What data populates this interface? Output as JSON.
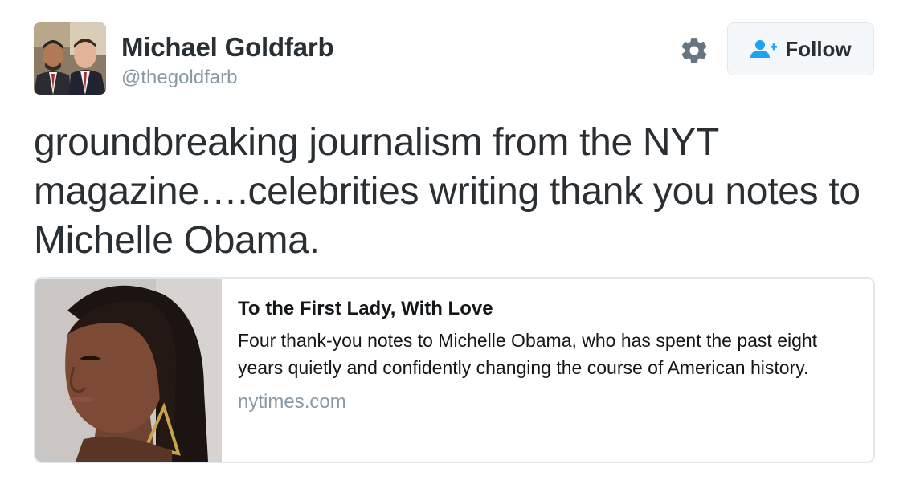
{
  "author": {
    "name": "Michael Goldfarb",
    "handle": "@thegoldfarb"
  },
  "actions": {
    "settings_icon": "gear-icon",
    "follow_icon": "add-user-icon",
    "follow_label": "Follow"
  },
  "tweet": {
    "text": "groundbreaking journalism from the NYT magazine….celebrities writing thank you notes to Michelle Obama."
  },
  "card": {
    "title": "To the First Lady, With Love",
    "description": "Four thank-you notes to Michelle Obama, who has spent the past eight years quietly and confidently changing the course of American history.",
    "domain": "nytimes.com"
  },
  "colors": {
    "text": "#292f33",
    "muted": "#8899a6",
    "accent": "#1da1f2",
    "border": "#e1e8ed",
    "button_bg": "#f5f8fa"
  }
}
